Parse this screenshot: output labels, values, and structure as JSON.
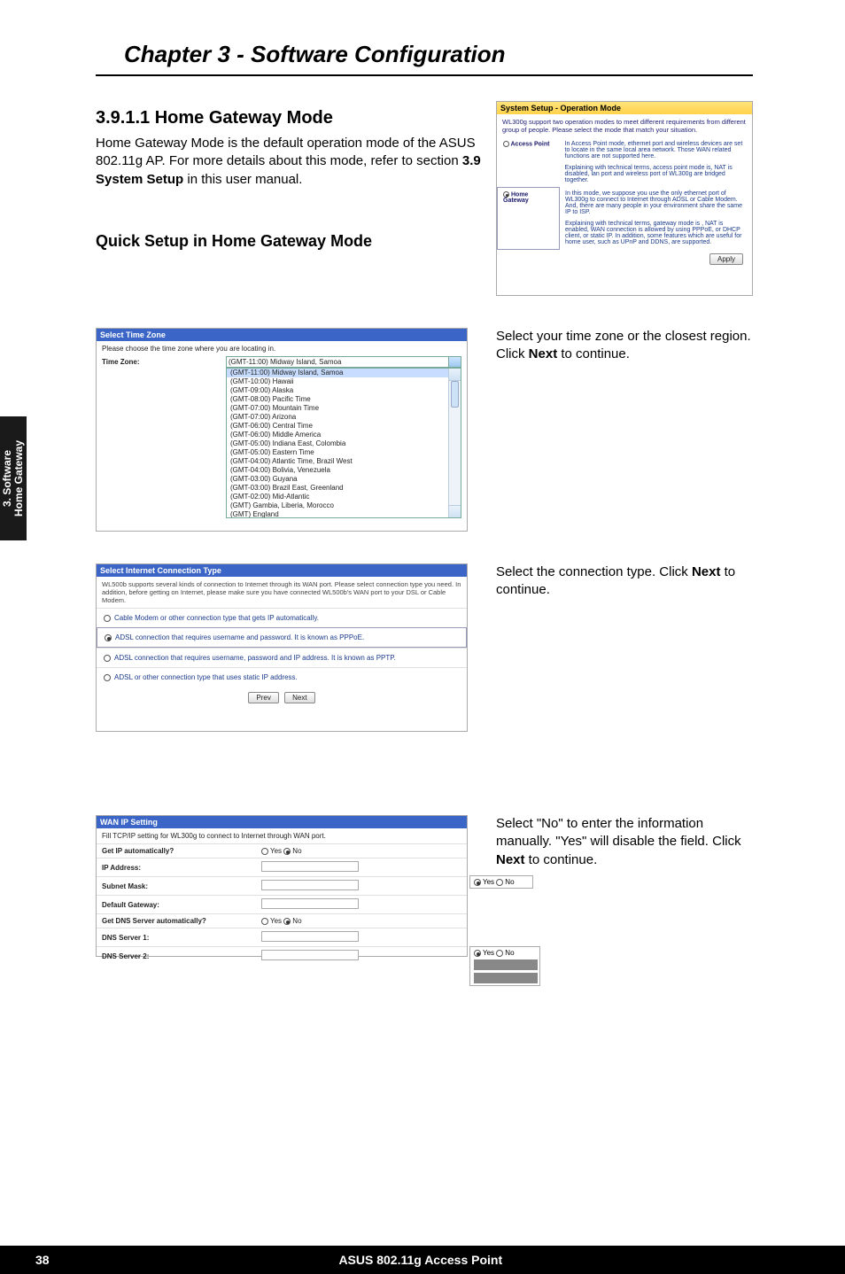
{
  "chapter_title": "Chapter 3 - Software Configuration",
  "section_number_title": "3.9.1.1 Home Gateway Mode",
  "body_para_1_pre": "Home Gateway Mode is the default operation mode of the ASUS 802.11g AP. For more details about this mode, refer to section ",
  "body_para_1_bold": "3.9 System Setup",
  "body_para_1_post": " in this user manual.",
  "quick_setup_heading": "Quick Setup in Home Gateway Mode",
  "side_tab_line1": "3. Software",
  "side_tab_line2": "Home Gateway",
  "footer_page": "38",
  "footer_title": "ASUS 802.11g Access Point",
  "sys_title": "System Setup - Operation Mode",
  "sys_desc": "WL300g support two operation modes to meet different requirements from different group of people. Please select the mode that match your situation.",
  "sys_modes": [
    {
      "label": "Access Point",
      "selected": false,
      "para_a": "In Access Point mode, ethernet port and wireless devices are set to locate in the same local area network. Those WAN related functions are not supported here.",
      "para_b": "Explaining with technical terms, access point mode is, NAT is disabled, lan port and wireless port of WL300g are bridged together."
    },
    {
      "label": "Home Gateway",
      "selected": true,
      "para_a": "In this mode, we suppose you use the only ethernet port of WL300g to connect to Internet through ADSL or Cable Modem. And, there are many people in your environment share the same IP to ISP.",
      "para_b": "Explaining with technical terms, gateway mode is , NAT is enabled, WAN connection is allowed by using PPPoE, or DHCP client, or static IP. In addition, some features which are useful for home user, such as UPnP and DDNS, are supported."
    }
  ],
  "apply_label": "Apply",
  "tz_title": "Select Time Zone",
  "tz_sub": "Please choose the time zone where you are locating in.",
  "tz_label": "Time Zone:",
  "tz_selected": "(GMT-11:00) Midway Island, Samoa",
  "tz_options": [
    "(GMT-11:00) Midway Island, Samoa",
    "(GMT-10:00) Hawaii",
    "(GMT-09:00) Alaska",
    "(GMT-08:00) Pacific Time",
    "(GMT-07:00) Mountain Time",
    "(GMT-07:00) Arizona",
    "(GMT-06:00) Central Time",
    "(GMT-06:00) Middle America",
    "(GMT-05:00) Indiana East, Colombia",
    "(GMT-05:00) Eastern Time",
    "(GMT-04:00) Atlantic Time, Brazil West",
    "(GMT-04:00) Bolivia, Venezuela",
    "(GMT-03:00) Guyana",
    "(GMT-03:00) Brazil East, Greenland",
    "(GMT-02:00) Mid-Atlantic",
    "(GMT) Gambia, Liberia, Morocco",
    "(GMT) England"
  ],
  "caption_tz_pre": "Select your time zone or the closest region. Click ",
  "caption_tz_bold": "Next",
  "caption_tz_post": " to continue.",
  "ct_title": "Select Internet Connection Type",
  "ct_desc": "WL500b supports several kinds of connection to Internet through its WAN port. Please select connection type you need. In addition, before getting on Internet, please make sure you have connected WL500b's WAN port to your DSL or Cable Modem.",
  "ct_options": [
    {
      "label": "Cable Modem or other connection type that gets IP automatically.",
      "selected": false
    },
    {
      "label": "ADSL connection that requires username and password. It is known as PPPoE.",
      "selected": true
    },
    {
      "label": "ADSL connection that requires username, password and IP address. It is known as PPTP.",
      "selected": false
    },
    {
      "label": "ADSL or other connection type that uses static IP address.",
      "selected": false
    }
  ],
  "prev_label": "Prev",
  "next_label": "Next",
  "caption_ct_pre": "Select the connection type. Click ",
  "caption_ct_bold": "Next",
  "caption_ct_post": " to continue.",
  "wan_title": "WAN IP Setting",
  "wan_desc": "Fill TCP/IP setting for WL300g to connect to Internet through WAN port.",
  "wan_rows": {
    "get_ip": "Get IP automatically?",
    "ip_addr": "IP Address:",
    "subnet": "Subnet Mask:",
    "gateway": "Default Gateway:",
    "get_dns": "Get DNS Server automatically?",
    "dns1": "DNS Server 1:",
    "dns2": "DNS Server 2:"
  },
  "yes_label": "Yes",
  "no_label": "No",
  "caption_wan": "Select \"No\" to enter the information manually. \"Yes\" will disable the field. Click ",
  "caption_wan_bold": "Next",
  "caption_wan_post": " to continue."
}
